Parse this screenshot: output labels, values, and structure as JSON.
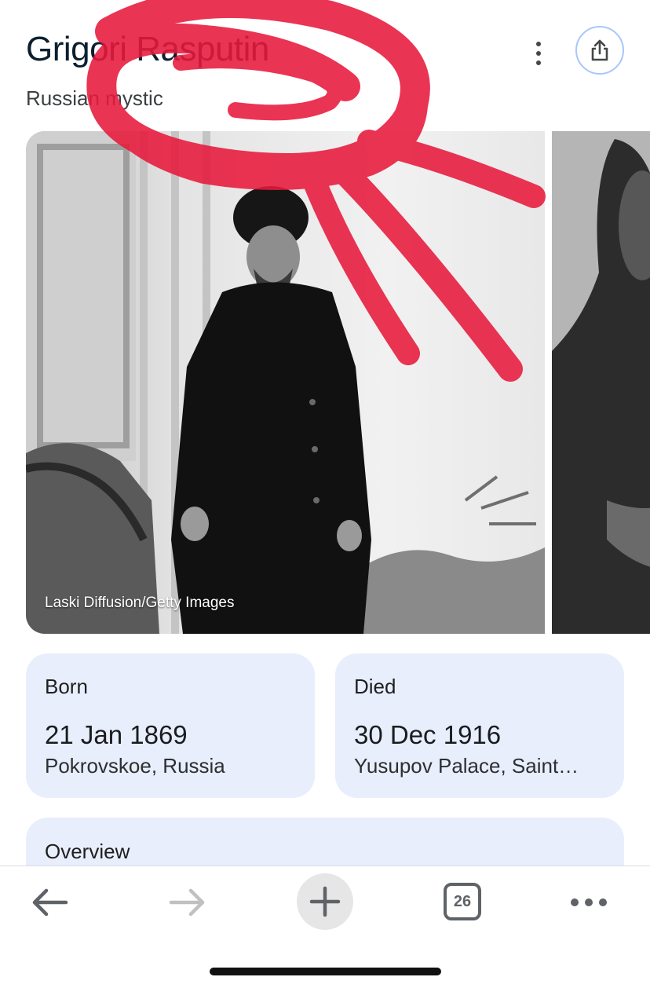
{
  "header": {
    "title": "Grigori Rasputin",
    "subtitle": "Russian mystic"
  },
  "icons": {
    "more": "kebab-vertical-icon",
    "share": "share-icon"
  },
  "gallery": {
    "main_image_credit": "Laski Diffusion/Getty Images"
  },
  "facts": {
    "born": {
      "label": "Born",
      "date": "21 Jan 1869",
      "place": "Pokrovskoe, Russia"
    },
    "died": {
      "label": "Died",
      "date": "30 Dec 1916",
      "place": "Yusupov Palace, Saint…"
    },
    "overview": {
      "label": "Overview"
    }
  },
  "toolbar": {
    "tab_count": "26"
  },
  "colors": {
    "card_bg": "#e8eefc",
    "annotation_scribble": "#e8193c",
    "share_ring": "#a8c7fa"
  }
}
